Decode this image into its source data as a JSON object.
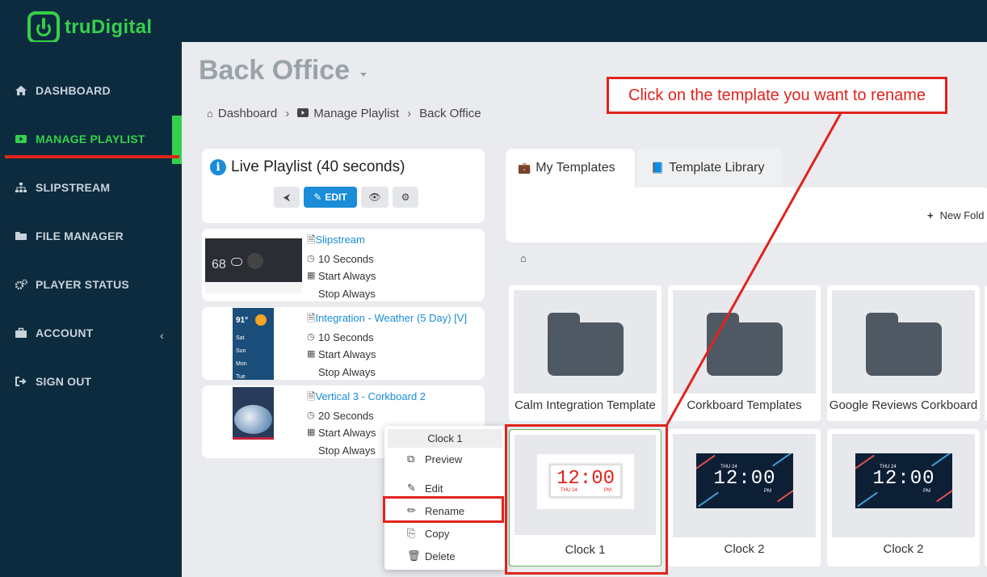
{
  "brand": {
    "name": "truDigital",
    "accent": "#35d04a"
  },
  "sidebar": {
    "items": [
      {
        "label": "DASHBOARD",
        "icon": "home-icon"
      },
      {
        "label": "MANAGE PLAYLIST",
        "icon": "play-icon",
        "active": true
      },
      {
        "label": "SLIPSTREAM",
        "icon": "sitemap-icon"
      },
      {
        "label": "FILE MANAGER",
        "icon": "folder-icon"
      },
      {
        "label": "PLAYER STATUS",
        "icon": "gears-icon"
      },
      {
        "label": "ACCOUNT",
        "icon": "briefcase-icon"
      },
      {
        "label": "SIGN OUT",
        "icon": "sign-out-icon"
      }
    ]
  },
  "header": {
    "title": "Back Office",
    "breadcrumb": [
      "Dashboard",
      "Manage Playlist",
      "Back Office"
    ]
  },
  "playlist": {
    "title": "Live Playlist (40 seconds)",
    "edit_label": "EDIT",
    "items": [
      {
        "name": "Slipstream",
        "duration": "10 Seconds",
        "start": "Start Always",
        "stop": "Stop Always"
      },
      {
        "name": "Integration - Weather (5 Day) [V]",
        "duration": "10 Seconds",
        "start": "Start Always",
        "stop": "Stop Always"
      },
      {
        "name": "Vertical 3 - Corkboard 2",
        "duration": "20 Seconds",
        "start": "Start Always",
        "stop": "Stop Always"
      }
    ],
    "thumb1": {
      "temp": "68"
    },
    "thumb2": {
      "temp": "91°",
      "days": [
        "Sat",
        "Sun",
        "Mon",
        "Tue"
      ]
    }
  },
  "context_menu": {
    "title": "Clock 1",
    "items": [
      "Preview",
      "Edit",
      "Rename",
      "Copy",
      "Delete"
    ]
  },
  "templates": {
    "tabs": [
      "My Templates",
      "Template Library"
    ],
    "new_folder": "New Fold",
    "folders": [
      "Calm Integration Template",
      "Corkboard Templates",
      "Google Reviews Corkboard"
    ],
    "clocks": [
      {
        "label": "Clock 1",
        "time": "12:00",
        "day": "THU 24",
        "ampm": "PM"
      },
      {
        "label": "Clock 2",
        "time": "12:00",
        "day": "THU 24",
        "ampm": "PM"
      },
      {
        "label": "Clock 2",
        "time": "12:00",
        "day": "THU 24",
        "ampm": "PM"
      }
    ]
  },
  "annotation": {
    "callout": "Click on the template you want to rename",
    "color": "#e0231d"
  }
}
